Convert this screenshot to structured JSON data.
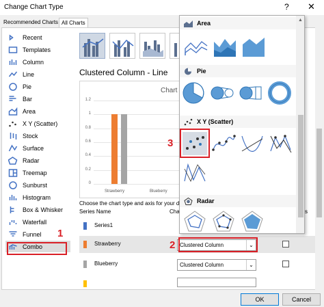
{
  "window": {
    "title": "Change Chart Type",
    "help": "?",
    "close": "✕"
  },
  "tabs": [
    "Recommended Charts",
    "All Charts"
  ],
  "sidebar": {
    "items": [
      "Recent",
      "Templates",
      "Column",
      "Line",
      "Pie",
      "Bar",
      "Area",
      "X Y (Scatter)",
      "Stock",
      "Surface",
      "Radar",
      "Treemap",
      "Sunburst",
      "Histogram",
      "Box & Whisker",
      "Waterfall",
      "Funnel",
      "Combo"
    ],
    "selected": "Combo"
  },
  "combo": {
    "subtitle": "Clustered Column - Line",
    "preview": {
      "title": "Chart"
    },
    "choose_label": "Choose the chart type and axis for your da",
    "series_header": "Series Name",
    "chart_type_header": "Cha",
    "series": [
      {
        "name": "Series1",
        "chart_type": "",
        "color": "#4472c4"
      },
      {
        "name": "Strawberry",
        "chart_type": "Clustered Column",
        "color": "#ed7d31"
      },
      {
        "name": "Blueberry",
        "chart_type": "Clustered Column",
        "color": "#a5a5a5"
      },
      {
        "name": "",
        "chart_type": "",
        "color": "#ffc000"
      }
    ],
    "secondary_axis_header": "s"
  },
  "chart_data": {
    "type": "bar",
    "title": "Chart",
    "categories": [
      "Strawberry",
      "Blueberry"
    ],
    "series": [
      {
        "name": "Strawberry",
        "values": [
          1,
          0
        ],
        "color": "#ed7d31"
      },
      {
        "name": "Blueberry",
        "values": [
          1,
          0
        ],
        "color": "#a5a5a5"
      }
    ],
    "y_ticks": [
      "1.2",
      "1",
      "0.8",
      "0.6",
      "0.4",
      "0.2",
      "0"
    ],
    "ylim": [
      0,
      1.2
    ]
  },
  "dropdown_panel": {
    "sections": [
      "Area",
      "Pie",
      "X Y (Scatter)",
      "Radar"
    ]
  },
  "annotations": {
    "marker1": "1",
    "marker2": "2",
    "marker3": "3"
  },
  "buttons": {
    "ok": "OK",
    "cancel": "Cancel"
  },
  "colors": {
    "accent": "#4472c4",
    "highlight": "#d91f26",
    "orange": "#ed7d31",
    "gray": "#a5a5a5"
  }
}
